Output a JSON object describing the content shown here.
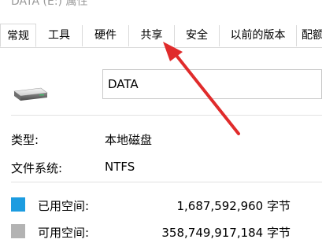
{
  "window": {
    "title": "DATA (E:) 属性"
  },
  "tabs": [
    {
      "label": "常规",
      "active": true
    },
    {
      "label": "工具",
      "active": false
    },
    {
      "label": "硬件",
      "active": false
    },
    {
      "label": "共享",
      "active": false
    },
    {
      "label": "安全",
      "active": false
    },
    {
      "label": "以前的版本",
      "active": false
    },
    {
      "label": "配额",
      "active": false
    }
  ],
  "general": {
    "drive_name": "DATA",
    "type_label": "类型:",
    "type_value": "本地磁盘",
    "fs_label": "文件系统:",
    "fs_value": "NTFS",
    "used_label": "已用空间:",
    "used_value": "1,687,592,960 字节",
    "free_label": "可用空间:",
    "free_value": "358,749,917,184 字节"
  },
  "colors": {
    "used_color": "#1c9ce0",
    "free_color": "#b3b3b3",
    "annotation_arrow": "#e02b2b"
  },
  "icons": {
    "drive": "drive-icon",
    "annotation": "red-arrow-annotation"
  }
}
